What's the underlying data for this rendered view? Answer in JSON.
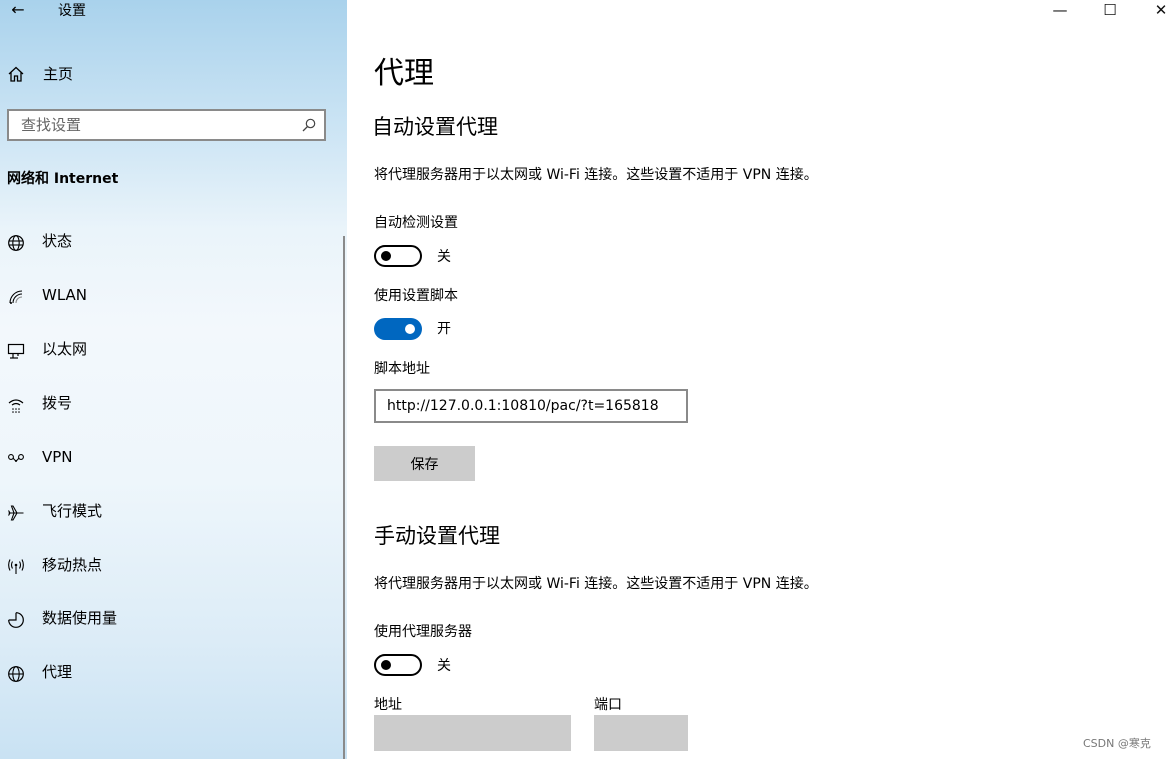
{
  "window": {
    "app_title": "设置",
    "back_glyph": "←",
    "minimize_glyph": "—",
    "maximize_glyph": "☐",
    "close_glyph": "✕"
  },
  "sidebar": {
    "home_label": "主页",
    "search_placeholder": "查找设置",
    "section_title": "网络和 Internet",
    "items": [
      {
        "label": "状态",
        "icon": "globe-status-icon"
      },
      {
        "label": "WLAN",
        "icon": "wifi-icon"
      },
      {
        "label": "以太网",
        "icon": "ethernet-icon"
      },
      {
        "label": "拨号",
        "icon": "dialup-icon"
      },
      {
        "label": "VPN",
        "icon": "vpn-icon"
      },
      {
        "label": "飞行模式",
        "icon": "airplane-icon"
      },
      {
        "label": "移动热点",
        "icon": "hotspot-icon"
      },
      {
        "label": "数据使用量",
        "icon": "data-usage-icon"
      },
      {
        "label": "代理",
        "icon": "globe-icon"
      }
    ]
  },
  "main": {
    "page_title": "代理",
    "auto": {
      "heading": "自动设置代理",
      "description": "将代理服务器用于以太网或 Wi-Fi 连接。这些设置不适用于 VPN 连接。",
      "detect_label": "自动检测设置",
      "detect_state": "关",
      "detect_on": false,
      "script_label": "使用设置脚本",
      "script_state": "开",
      "script_on": true,
      "address_label": "脚本地址",
      "address_value": "http://127.0.0.1:10810/pac/?t=165818",
      "save_label": "保存"
    },
    "manual": {
      "heading": "手动设置代理",
      "description": "将代理服务器用于以太网或 Wi-Fi 连接。这些设置不适用于 VPN 连接。",
      "proxy_label": "使用代理服务器",
      "proxy_state": "关",
      "proxy_on": false,
      "address_label": "地址",
      "port_label": "端口",
      "address_value": "",
      "port_value": ""
    }
  },
  "watermark": "CSDN @寒克",
  "colors": {
    "accent": "#0067c0",
    "disabled_input": "#cccccc"
  }
}
